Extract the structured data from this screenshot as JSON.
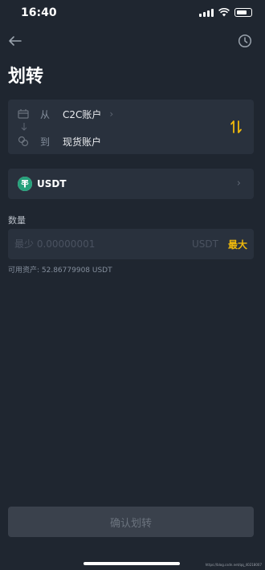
{
  "status_bar": {
    "time": "16:40"
  },
  "header": {
    "title": "划转"
  },
  "transfer": {
    "from_label": "从",
    "from_account": "C2C账户",
    "to_label": "到",
    "to_account": "现货账户"
  },
  "coin": {
    "name": "USDT"
  },
  "amount": {
    "label": "数量",
    "placeholder": "最少 0.00000001",
    "unit": "USDT",
    "max_label": "最大"
  },
  "available": {
    "text": "可用资产: 52.86779908 USDT"
  },
  "confirm": {
    "label": "确认划转"
  },
  "watermark": "https://blog.csdn.net/qq_40218007",
  "colors": {
    "background": "#1f2630",
    "card": "#29313d",
    "accent": "#f0b90b",
    "usdt": "#26a17b"
  }
}
